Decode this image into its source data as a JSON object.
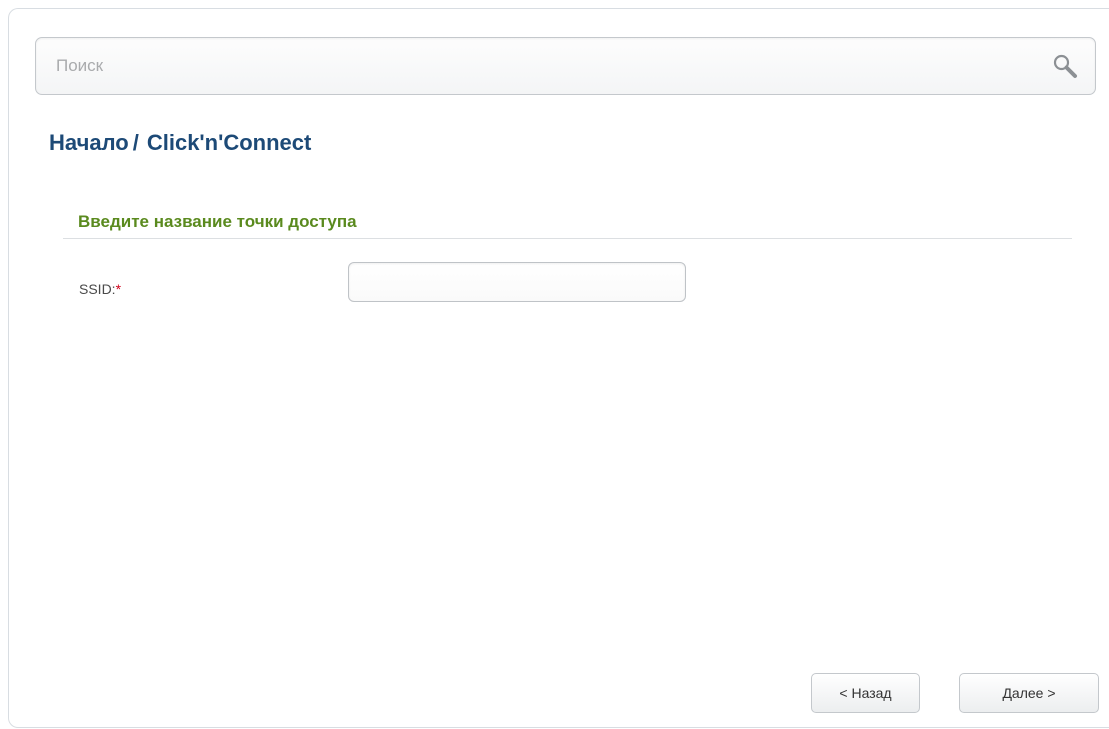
{
  "search": {
    "placeholder": "Поиск",
    "icon": "search-icon"
  },
  "breadcrumb": {
    "home": "Начало",
    "separator": "/",
    "current": "Click'n'Connect"
  },
  "section": {
    "title": "Введите название точки доступа"
  },
  "form": {
    "ssid_label": "SSID:",
    "required_mark": "*",
    "ssid_value": ""
  },
  "buttons": {
    "back": "< Назад",
    "next": "Далее >"
  },
  "colors": {
    "title": "#1d4a77",
    "section_title": "#5a8a1e",
    "required": "#d0021b"
  }
}
